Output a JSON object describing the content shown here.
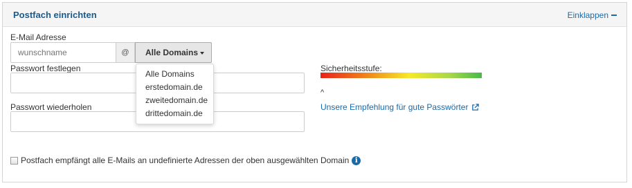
{
  "panel": {
    "title": "Postfach einrichten",
    "collapse_label": "Einklappen"
  },
  "email": {
    "label": "E-Mail Adresse",
    "placeholder": "wunschname",
    "at_symbol": "@",
    "domain_selected": "Alle Domains",
    "domain_options": [
      "Alle Domains",
      "erstedomain.de",
      "zweitedomain.de",
      "drittedomain.de"
    ]
  },
  "password": {
    "label": "Passwort festlegen",
    "value": ""
  },
  "password_repeat": {
    "label": "Passwort wiederholen",
    "value": ""
  },
  "strength": {
    "label": "Sicherheitsstufe:",
    "indicator": "^",
    "recommend_link": "Unsere Empfehlung für gute Passwörter",
    "gradient_colors": [
      "#e8231a",
      "#f08a1c",
      "#f7e92a",
      "#a8d84a",
      "#47b94a"
    ]
  },
  "catch_all": {
    "label": "Postfach empfängt alle E-Mails an undefinierte Adressen der oben ausgewählten Domain",
    "checked": false
  },
  "icons": {
    "collapse": "minus-icon",
    "external": "external-link-icon",
    "info": "info-icon",
    "caret": "caret-down-icon"
  },
  "colors": {
    "accent": "#1a6aa8",
    "title": "#1a5a8c"
  }
}
